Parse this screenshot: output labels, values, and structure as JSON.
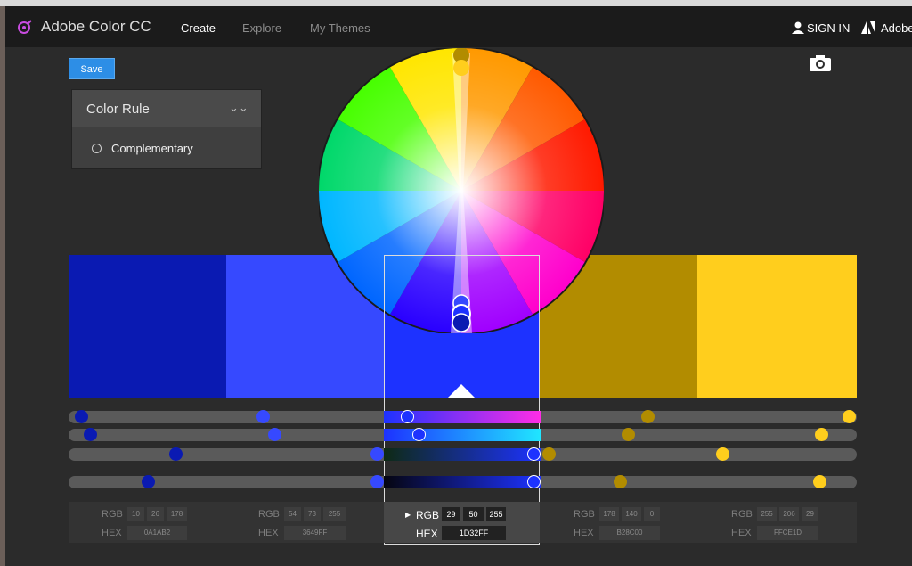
{
  "header": {
    "brand": "Adobe Color CC",
    "nav": [
      "Create",
      "Explore",
      "My Themes"
    ],
    "signin": "SIGN IN",
    "adobe": "Adobe"
  },
  "toolbar": {
    "save_label": "Save"
  },
  "color_rule": {
    "title": "Color Rule",
    "option": "Complementary"
  },
  "swatches": [
    {
      "hex": "0A1AB2",
      "rgb": [
        "10",
        "26",
        "178"
      ]
    },
    {
      "hex": "3649FF",
      "rgb": [
        "54",
        "73",
        "255"
      ]
    },
    {
      "hex": "1D32FF",
      "rgb": [
        "29",
        "50",
        "255"
      ]
    },
    {
      "hex": "B28C00",
      "rgb": [
        "178",
        "140",
        "0"
      ]
    },
    {
      "hex": "FFCE1D",
      "rgb": [
        "255",
        "206",
        "29"
      ]
    }
  ],
  "labels": {
    "rgb": "RGB",
    "hex": "HEX"
  },
  "colors": {
    "sw1": "#0a1ab2",
    "sw2": "#3649ff",
    "sw3": "#1d32ff",
    "sw4": "#b28c00",
    "sw5": "#ffce1d",
    "accent": "#2d8ee6"
  }
}
